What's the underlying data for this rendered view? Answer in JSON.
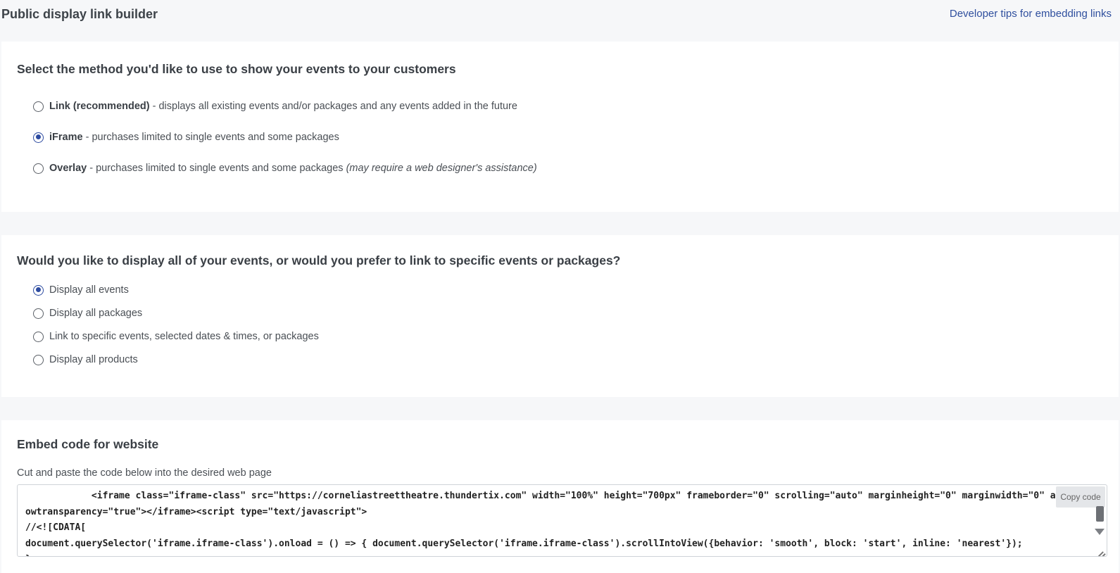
{
  "header": {
    "title": "Public display link builder",
    "dev_tips_link": "Developer tips for embedding links"
  },
  "method_section": {
    "heading": "Select the method you'd like to use to show your events to your customers",
    "options": [
      {
        "strong": "Link (recommended)",
        "text": " - displays all existing events and/or packages and any events added in the future",
        "em": "",
        "checked": false
      },
      {
        "strong": "iFrame",
        "text": " - purchases limited to single events and some packages",
        "em": "",
        "checked": true
      },
      {
        "strong": "Overlay",
        "text": " - purchases limited to single events and some packages ",
        "em": "(may require a web designer's assistance)",
        "checked": false
      }
    ]
  },
  "display_section": {
    "heading": "Would you like to display all of your events, or would you prefer to link to specific events or packages?",
    "options": [
      {
        "label": "Display all events",
        "checked": true
      },
      {
        "label": "Display all packages",
        "checked": false
      },
      {
        "label": "Link to specific events, selected dates & times, or packages",
        "checked": false
      },
      {
        "label": "Display all products",
        "checked": false
      }
    ]
  },
  "embed_section": {
    "heading": "Embed code for website",
    "subtext": "Cut and paste the code below into the desired web page",
    "copy_button": "Copy code",
    "code": "            <iframe class=\"iframe-class\" src=\"https://corneliastreettheatre.thundertix.com\" width=\"100%\" height=\"700px\" frameborder=\"0\" scrolling=\"auto\" marginheight=\"0\" marginwidth=\"0\" allowtransparency=\"true\"></iframe><script type=\"text/javascript\">\n//<![CDATA[\ndocument.querySelector('iframe.iframe-class').onload = () => { document.querySelector('iframe.iframe-class').scrollIntoView({behavior: 'smooth', block: 'start', inline: 'nearest'});\n};"
  },
  "colors": {
    "accent": "#2d4ba0",
    "link": "#2f4f9e",
    "background": "#f6f7f9"
  }
}
